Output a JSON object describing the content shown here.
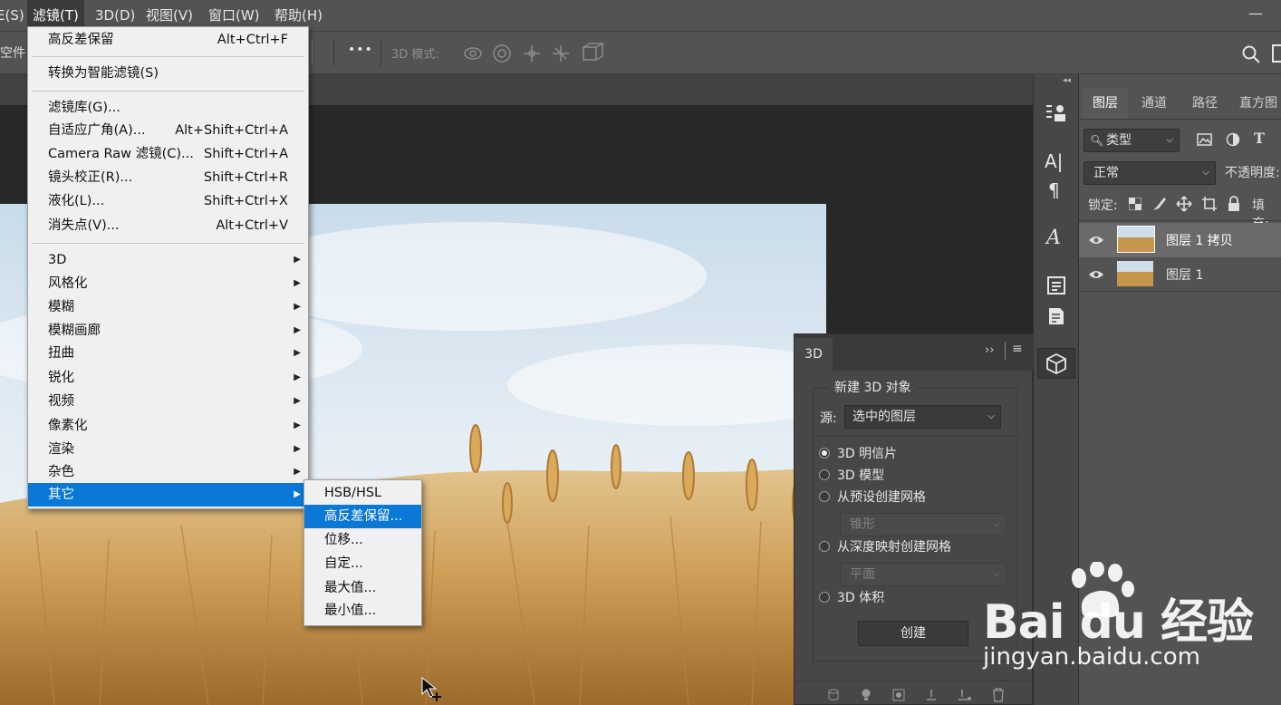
{
  "menubar": {
    "items": [
      "E(S)",
      "滤镜(T)",
      "3D(D)",
      "视图(V)",
      "窗口(W)",
      "帮助(H)"
    ],
    "active": "滤镜(T)"
  },
  "options_bar": {
    "left_label": "空件",
    "more": "•••",
    "mode_label": "3D 模式:"
  },
  "filter_menu": {
    "items": [
      {
        "label": "高反差保留",
        "shortcut": "Alt+Ctrl+F"
      },
      {
        "label": "转换为智能滤镜(S)",
        "shortcut": ""
      },
      {
        "label": "滤镜库(G)...",
        "shortcut": ""
      },
      {
        "label": "自适应广角(A)...",
        "shortcut": "Alt+Shift+Ctrl+A"
      },
      {
        "label": "Camera Raw 滤镜(C)...",
        "shortcut": "Shift+Ctrl+A"
      },
      {
        "label": "镜头校正(R)...",
        "shortcut": "Shift+Ctrl+R"
      },
      {
        "label": "液化(L)...",
        "shortcut": "Shift+Ctrl+X"
      },
      {
        "label": "消失点(V)...",
        "shortcut": "Alt+Ctrl+V"
      },
      {
        "label": "3D",
        "shortcut": ""
      },
      {
        "label": "风格化",
        "shortcut": ""
      },
      {
        "label": "模糊",
        "shortcut": ""
      },
      {
        "label": "模糊画廊",
        "shortcut": ""
      },
      {
        "label": "扭曲",
        "shortcut": ""
      },
      {
        "label": "锐化",
        "shortcut": ""
      },
      {
        "label": "视频",
        "shortcut": ""
      },
      {
        "label": "像素化",
        "shortcut": ""
      },
      {
        "label": "渲染",
        "shortcut": ""
      },
      {
        "label": "杂色",
        "shortcut": ""
      },
      {
        "label": "其它",
        "shortcut": ""
      }
    ],
    "submenu_arrow": "▶"
  },
  "other_submenu": {
    "items": [
      "HSB/HSL",
      "高反差保留...",
      "位移...",
      "自定...",
      "最大值...",
      "最小值..."
    ],
    "highlighted": "高反差保留..."
  },
  "layers_panel": {
    "tabs": [
      "图层",
      "通道",
      "路径",
      "直方图"
    ],
    "active_tab": "图层",
    "filter_kind": "类型",
    "blend_mode": "正常",
    "opacity_label": "不透明度:",
    "lock_label": "锁定:",
    "fill_label": "填充:",
    "layers": [
      {
        "name": "图层 1 拷贝",
        "selected": true
      },
      {
        "name": "图层 1",
        "selected": false
      }
    ]
  },
  "panel_3d": {
    "tab": "3D",
    "group_title": "新建 3D 对象",
    "source_label": "源:",
    "source_value": "选中的图层",
    "options": [
      "3D 明信片",
      "3D 模型",
      "从预设创建网格",
      "从深度映射创建网格",
      "3D 体积"
    ],
    "selected_option": "3D 明信片",
    "preset_value": "锥形",
    "depth_value": "平面",
    "create_button": "创建"
  },
  "watermark": {
    "brand": "Bai du 经验",
    "url": "jingyan.baidu.com"
  },
  "colors": {
    "menu_highlight": "#0a78d7",
    "panel_bg": "#535353",
    "canvas_bg": "#282828"
  }
}
